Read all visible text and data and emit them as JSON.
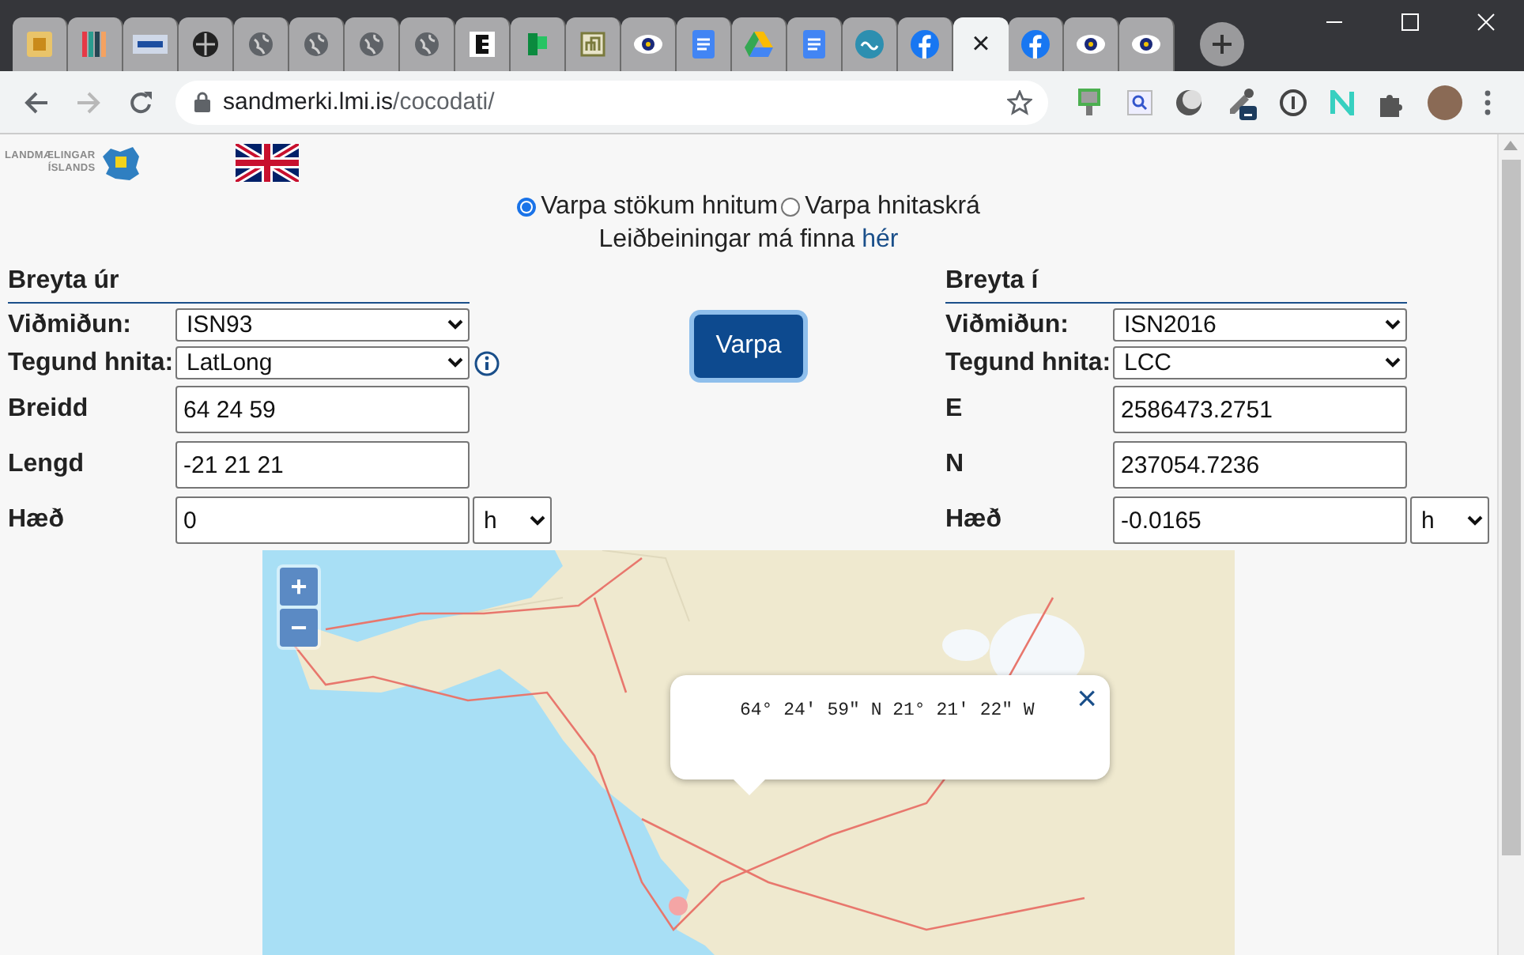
{
  "browser": {
    "tabs": [
      {
        "kind": "yellow",
        "selected": false
      },
      {
        "kind": "bars",
        "selected": false
      },
      {
        "kind": "tile",
        "selected": false
      },
      {
        "kind": "darkglobe",
        "selected": false
      },
      {
        "kind": "globe",
        "selected": false
      },
      {
        "kind": "globe",
        "selected": false
      },
      {
        "kind": "globe",
        "selected": false
      },
      {
        "kind": "globe",
        "selected": false
      },
      {
        "kind": "letter",
        "selected": false
      },
      {
        "kind": "green",
        "selected": false
      },
      {
        "kind": "square",
        "selected": false
      },
      {
        "kind": "eye",
        "selected": false
      },
      {
        "kind": "docs",
        "selected": false
      },
      {
        "kind": "drive",
        "selected": false
      },
      {
        "kind": "docs",
        "selected": false
      },
      {
        "kind": "round",
        "selected": false
      },
      {
        "kind": "facebook",
        "selected": false
      },
      {
        "kind": "blank",
        "selected": true
      },
      {
        "kind": "facebook",
        "selected": false
      },
      {
        "kind": "eye",
        "selected": false
      },
      {
        "kind": "eye",
        "selected": false
      }
    ],
    "tab_close": "×",
    "address": {
      "host": "sandmerki.lmi.is",
      "path": "/cocodati/"
    },
    "extensions": [
      {
        "kind": "monitor"
      },
      {
        "kind": "search"
      },
      {
        "kind": "circle"
      },
      {
        "kind": "dropper"
      },
      {
        "kind": "info"
      },
      {
        "kind": "nmark"
      },
      {
        "kind": "puzzle"
      }
    ]
  },
  "page": {
    "logo": {
      "line_1": "LANDMÆLINGAR",
      "line_2": "ÍSLANDS"
    },
    "modes": [
      {
        "label": "Varpa stökum hnitum",
        "selected": true
      },
      {
        "label": "Varpa hnitaskrá",
        "selected": false
      }
    ],
    "help": {
      "text": "Leiðbeiningar má finna",
      "link": "hér"
    },
    "from": {
      "title": "Breyta úr",
      "rows": [
        {
          "kind": "select",
          "label": "Viðmiðun:",
          "value": "ISN93",
          "info": false
        },
        {
          "kind": "select",
          "label": "Tegund hnita:",
          "value": "LatLong",
          "info": true
        },
        {
          "kind": "input",
          "label": "Breidd",
          "value": "64 24 59",
          "info": false
        },
        {
          "kind": "input",
          "label": "Lengd",
          "value": "-21 21 21",
          "info": false
        },
        {
          "kind": "unit",
          "label": "Hæð",
          "value": "0",
          "unit": "h",
          "info": false
        }
      ]
    },
    "convert_button": "Varpa",
    "to": {
      "title": "Breyta í",
      "rows": [
        {
          "kind": "select",
          "label": "Viðmiðun:",
          "value": "ISN2016",
          "info": false
        },
        {
          "kind": "select",
          "label": "Tegund hnita:",
          "value": "LCC",
          "info": false
        },
        {
          "kind": "input",
          "label": "E",
          "value": "2586473.2751",
          "info": false
        },
        {
          "kind": "input",
          "label": "N",
          "value": "237054.7236",
          "info": false
        },
        {
          "kind": "unit",
          "label": "Hæð",
          "value": "-0.0165",
          "unit": "h",
          "info": false
        }
      ]
    },
    "map": {
      "zoom_in": "+",
      "zoom_out": "−",
      "popup": {
        "text": "64° 24′ 59″ N 21° 21′ 22″ W",
        "close": "×"
      }
    }
  }
}
